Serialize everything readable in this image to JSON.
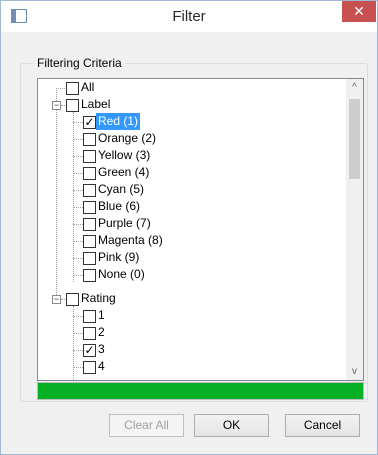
{
  "window": {
    "title": "Filter",
    "close_glyph": "✕",
    "app_icon": "window-icon"
  },
  "group": {
    "label": "Filtering Criteria"
  },
  "tree": {
    "all_label": "All",
    "label_group": "Label",
    "label_items": [
      {
        "label": "Red (1)",
        "checked": true,
        "selected": true
      },
      {
        "label": "Orange (2)",
        "checked": false
      },
      {
        "label": "Yellow (3)",
        "checked": false
      },
      {
        "label": "Green (4)",
        "checked": false
      },
      {
        "label": "Cyan (5)",
        "checked": false
      },
      {
        "label": "Blue (6)",
        "checked": false
      },
      {
        "label": "Purple (7)",
        "checked": false
      },
      {
        "label": "Magenta (8)",
        "checked": false
      },
      {
        "label": "Pink (9)",
        "checked": false
      },
      {
        "label": "None (0)",
        "checked": false
      }
    ],
    "rating_group": "Rating",
    "rating_items": [
      {
        "label": "1",
        "checked": false
      },
      {
        "label": "2",
        "checked": false
      },
      {
        "label": "3",
        "checked": true
      },
      {
        "label": "4",
        "checked": false
      }
    ],
    "expander_glyph": "−",
    "check_glyph": "✓"
  },
  "scrollbar": {
    "up_glyph": "^",
    "down_glyph": "v"
  },
  "progress": {
    "value_fraction": 1.0,
    "color": "#06b025"
  },
  "buttons": {
    "clear_all": "Clear All",
    "ok": "OK",
    "cancel": "Cancel"
  },
  "colors": {
    "selection": "#3399ff",
    "close_button": "#c75050"
  }
}
